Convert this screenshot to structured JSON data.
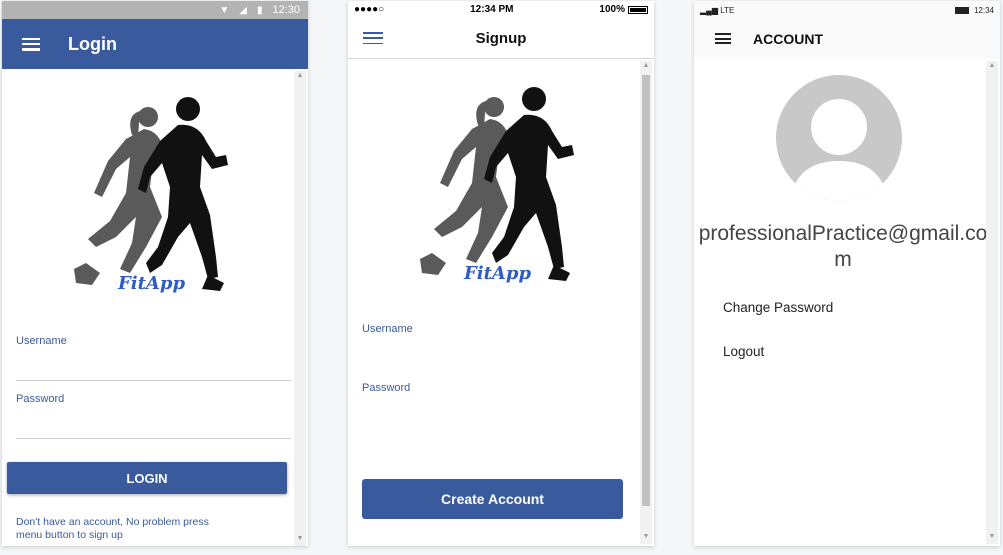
{
  "login_screen": {
    "status": {
      "time": "12:30"
    },
    "title": "Login",
    "logo_text": "FitApp",
    "username_label": "Username",
    "password_label": "Password",
    "login_button": "LOGIN",
    "hint": "Don't have an account, No problem press menu button to sign up",
    "colors": {
      "primary": "#3a5a9e"
    }
  },
  "signup_screen": {
    "status": {
      "signal": "●●●●○",
      "time": "12:34 PM",
      "battery": "100%"
    },
    "title": "Signup",
    "logo_text": "FitApp",
    "username_label": "Username",
    "password_label": "Password",
    "create_button": "Create Account"
  },
  "account_screen": {
    "status": {
      "network": "LTE",
      "time": "12:34"
    },
    "title": "ACCOUNT",
    "email": "professionalPractice@gmail.com",
    "menu_items": [
      {
        "label": "Change Password"
      },
      {
        "label": "Logout"
      }
    ]
  }
}
